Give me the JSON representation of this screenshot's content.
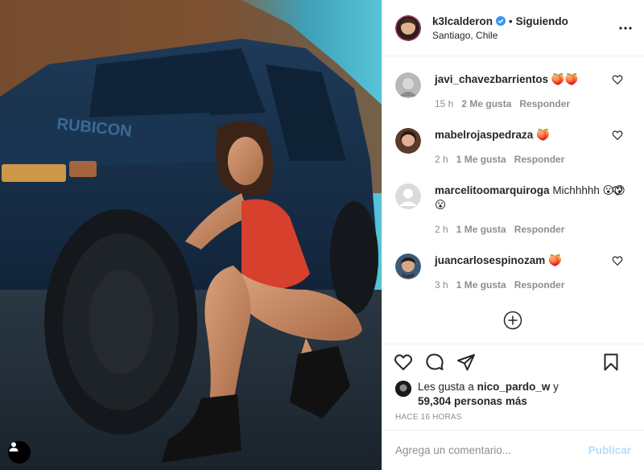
{
  "post": {
    "photo_alt": "",
    "author": {
      "username": "k3lcalderon",
      "verified": true,
      "follow_status": "Siguiendo",
      "separator": "•",
      "location": "Santiago, Chile",
      "avatar_icon": "avatar-icon"
    },
    "more_icon": "more-options-icon"
  },
  "comments": [
    {
      "username": "javi_chavezbarrientos",
      "text": "🍑🍑",
      "time": "15 h",
      "likes": "2 Me gusta",
      "reply": "Responder",
      "avatar_color": "#b8b8b8"
    },
    {
      "username": "mabelrojaspedraza",
      "text": "🍑",
      "time": "2 h",
      "likes": "1 Me gusta",
      "reply": "Responder",
      "avatar_color": "#5a3a2a"
    },
    {
      "username": "marcelitoomarquiroga",
      "text": "Michhhhh 😮😮😮",
      "time": "2 h",
      "likes": "1 Me gusta",
      "reply": "Responder",
      "avatar_color": "#dbdbdb"
    },
    {
      "username": "juancarlosespinozam",
      "text": "🍑",
      "time": "3 h",
      "likes": "1 Me gusta",
      "reply": "Responder",
      "avatar_color": "#3a5a7a"
    }
  ],
  "likes": {
    "prefix": "Les gusta a",
    "user": "nico_pardo_w",
    "conj": "y",
    "count": "59,304 personas más"
  },
  "timestamp": "HACE 16 HORAS",
  "add_comment": {
    "placeholder": "Agrega un comentario...",
    "publish_label": "Publicar"
  },
  "colors": {
    "verified": "#3897f0",
    "publish_disabled": "#b2dffc",
    "muted": "#8e8e8e"
  }
}
